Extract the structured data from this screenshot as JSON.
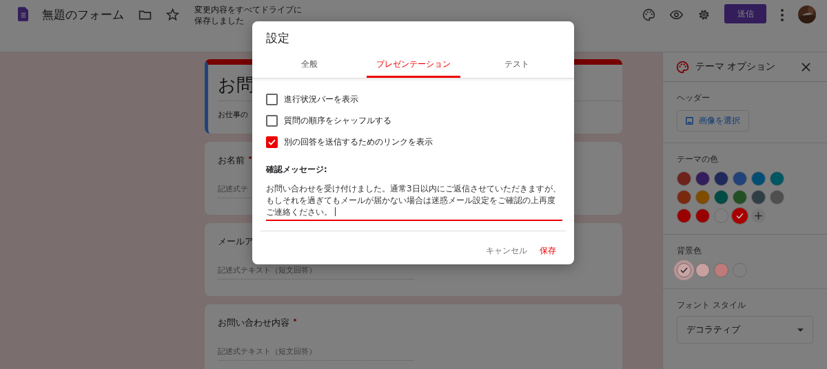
{
  "header": {
    "title": "無題のフォーム",
    "save_status": [
      "変更内容をすべてドライブに",
      "保存しました"
    ],
    "send_button": "送信"
  },
  "form": {
    "title": "お問",
    "description": "お仕事の",
    "questions": [
      {
        "label": "お名前",
        "required": true,
        "placeholder": "記述式テ"
      },
      {
        "label": "メールア",
        "placeholder": "記述式テキスト（短文回答）"
      },
      {
        "label": "お問い合わせ内容",
        "required": true,
        "placeholder": "記述式テキスト（短文回答）"
      }
    ]
  },
  "theme_panel": {
    "title": "テーマ オプション",
    "header_label": "ヘッダー",
    "image_button": "画像を選択",
    "theme_color_label": "テーマの色",
    "theme_colors": [
      {
        "color": "#6e221c",
        "selected": false
      },
      {
        "color": "#341d5c",
        "selected": false
      },
      {
        "color": "#20295b",
        "selected": false
      },
      {
        "color": "#21437a",
        "selected": false
      },
      {
        "color": "#024e73",
        "selected": false
      },
      {
        "color": "#005661",
        "selected": false
      },
      {
        "color": "#7a290f",
        "selected": false
      },
      {
        "color": "#804c00",
        "selected": false
      },
      {
        "color": "#004b44",
        "selected": false
      },
      {
        "color": "#225024",
        "selected": false
      },
      {
        "color": "#303f46",
        "selected": false
      },
      {
        "color": "#4f4f4f",
        "selected": false
      },
      {
        "color": "#9a0000",
        "selected": false
      },
      {
        "color": "#980000",
        "selected": false
      },
      {
        "color": "#808080",
        "selected": false
      },
      {
        "color": "#a80000",
        "selected": true
      }
    ],
    "background_label": "背景色",
    "background_colors": [
      {
        "color": "#c8a4a4",
        "selected": true
      },
      {
        "color": "#c8a0a0",
        "selected": false
      },
      {
        "color": "#c07a7a",
        "selected": false
      },
      {
        "color": "#808080",
        "selected": false
      }
    ],
    "font_label": "フォント スタイル",
    "font_value": "デコラティブ"
  },
  "dialog": {
    "title": "設定",
    "tabs": [
      {
        "label": "全般",
        "selected": false
      },
      {
        "label": "プレゼンテーション",
        "selected": true
      },
      {
        "label": "テスト",
        "selected": false
      }
    ],
    "options": [
      {
        "label": "進行状況バーを表示",
        "checked": false
      },
      {
        "label": "質問の順序をシャッフルする",
        "checked": false
      },
      {
        "label": "別の回答を送信するためのリンクを表示",
        "checked": true
      }
    ],
    "message_label": "確認メッセージ:",
    "message_value": "お問い合わせを受け付けました。通常3日以内にご返信させていただきますが、もしそれを過ぎてもメールが届かない場合は迷惑メール設定をご確認の上再度ご連絡ください。",
    "buttons": [
      "キャンセル",
      "保存"
    ]
  }
}
